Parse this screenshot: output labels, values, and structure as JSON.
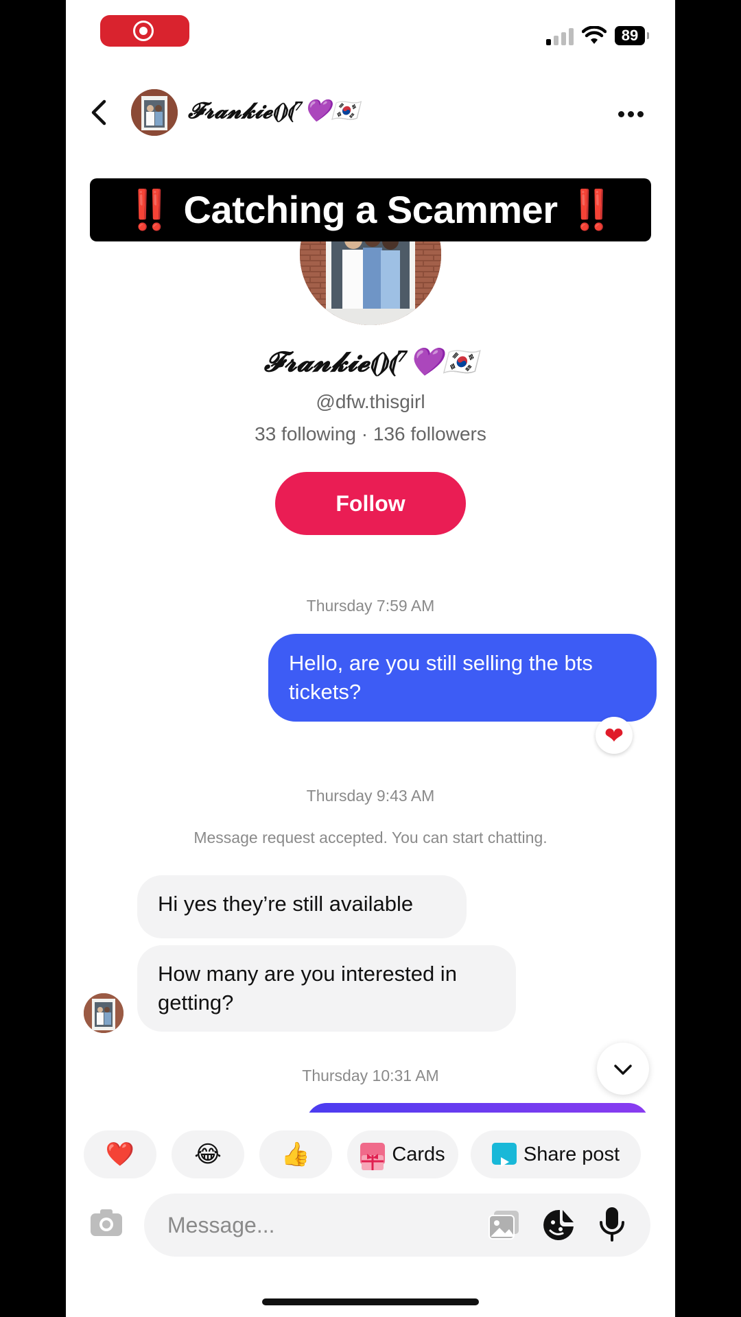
{
  "status_bar": {
    "battery": "89"
  },
  "header": {
    "name": "𝓕𝓻𝓪𝓷𝓴𝓲𝓮⟬⟭⟬⁷💜🇰🇷",
    "back_icon": "chevron-left-icon",
    "more_icon": "more-horizontal-icon"
  },
  "overlay": {
    "bang_left": "‼️",
    "title": "Catching a Scammer",
    "bang_right": "‼️"
  },
  "profile": {
    "name": "𝓕𝓻𝓪𝓷𝓴𝓲𝓮⟬⟭⟬⁷💜🇰🇷",
    "handle": "@dfw.thisgirl",
    "stats": "33 following · 136 followers",
    "follow_label": "Follow"
  },
  "messages": {
    "ts1": "Thursday 7:59 AM",
    "out1": "Hello, are you still selling the bts tickets?",
    "reaction1": "❤",
    "ts2": "Thursday 9:43 AM",
    "system1": "Message request accepted. You can start chatting.",
    "in1": "Hi yes they’re still available",
    "in2": "How many are you interested in getting?",
    "ts3": "Thursday 10:31 AM"
  },
  "quick_replies": {
    "heart": "❤️",
    "laugh": "😂",
    "thumbs": "👍",
    "cards": "Cards",
    "share": "Share post"
  },
  "composer": {
    "placeholder": "Message..."
  },
  "colors": {
    "follow": "#ea1d54",
    "bubble_out": "#3d5cf5",
    "record": "#d9232e"
  }
}
